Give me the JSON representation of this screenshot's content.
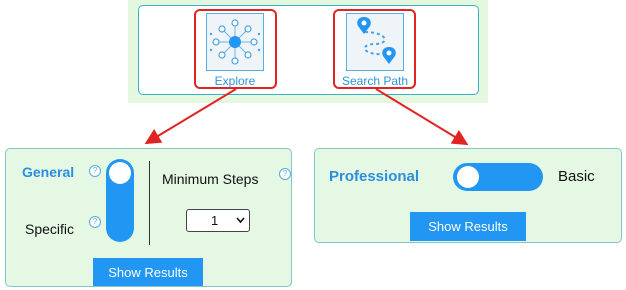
{
  "tools": {
    "explore_label": "Explore",
    "search_path_label": "Search Path"
  },
  "left_panel": {
    "general_label": "General",
    "specific_label": "Specific",
    "help_glyph": "?",
    "minimum_steps_label": "Minimum Steps",
    "steps_value": "1",
    "steps_options": [
      "1"
    ],
    "show_results_label": "Show Results"
  },
  "right_panel": {
    "professional_label": "Professional",
    "basic_label": "Basic",
    "show_results_label": "Show Results"
  },
  "colors": {
    "accent_blue": "#2196f3",
    "panel_green": "#e4f8e4",
    "highlight_red": "#e32222",
    "title_blue": "#2d8fdc"
  }
}
